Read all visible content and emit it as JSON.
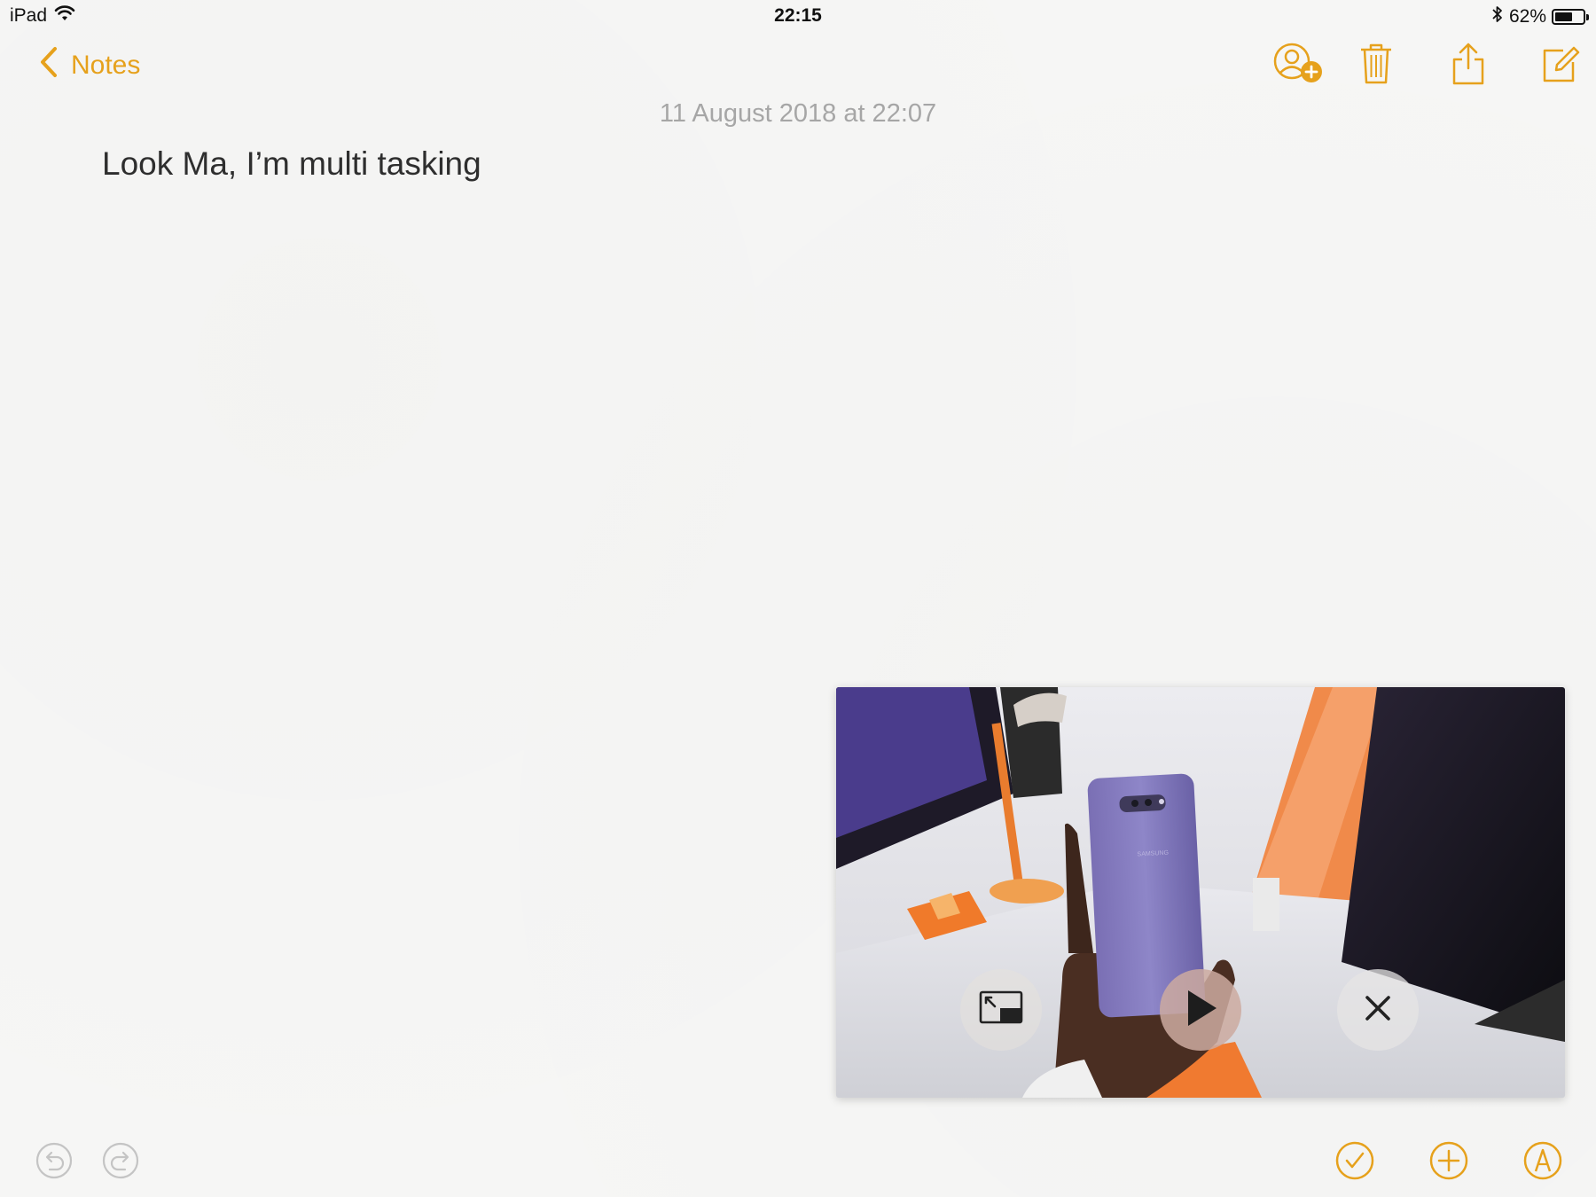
{
  "status_bar": {
    "device": "iPad",
    "time": "22:15",
    "battery_percent": "62%",
    "battery_level": 0.62,
    "icons": [
      "wifi-icon",
      "bluetooth-icon",
      "battery-icon"
    ]
  },
  "nav": {
    "back_label": "Notes",
    "back_icon": "chevron-left-icon",
    "actions": [
      "add-person-icon",
      "trash-icon",
      "share-icon",
      "compose-icon"
    ]
  },
  "note": {
    "date": "11 August 2018 at 22:07",
    "body": "Look Ma, I’m multi tasking"
  },
  "pip": {
    "controls": [
      "restore-icon",
      "play-icon",
      "close-icon"
    ],
    "phone_brand": "SAMSUNG"
  },
  "toolbar_bottom": {
    "left": [
      "undo-icon",
      "redo-icon"
    ],
    "right": [
      "checklist-icon",
      "add-icon",
      "markup-icon"
    ]
  },
  "colors": {
    "accent": "#e6a11c",
    "background": "#f6f6f5",
    "muted": "#a6a6a6"
  }
}
